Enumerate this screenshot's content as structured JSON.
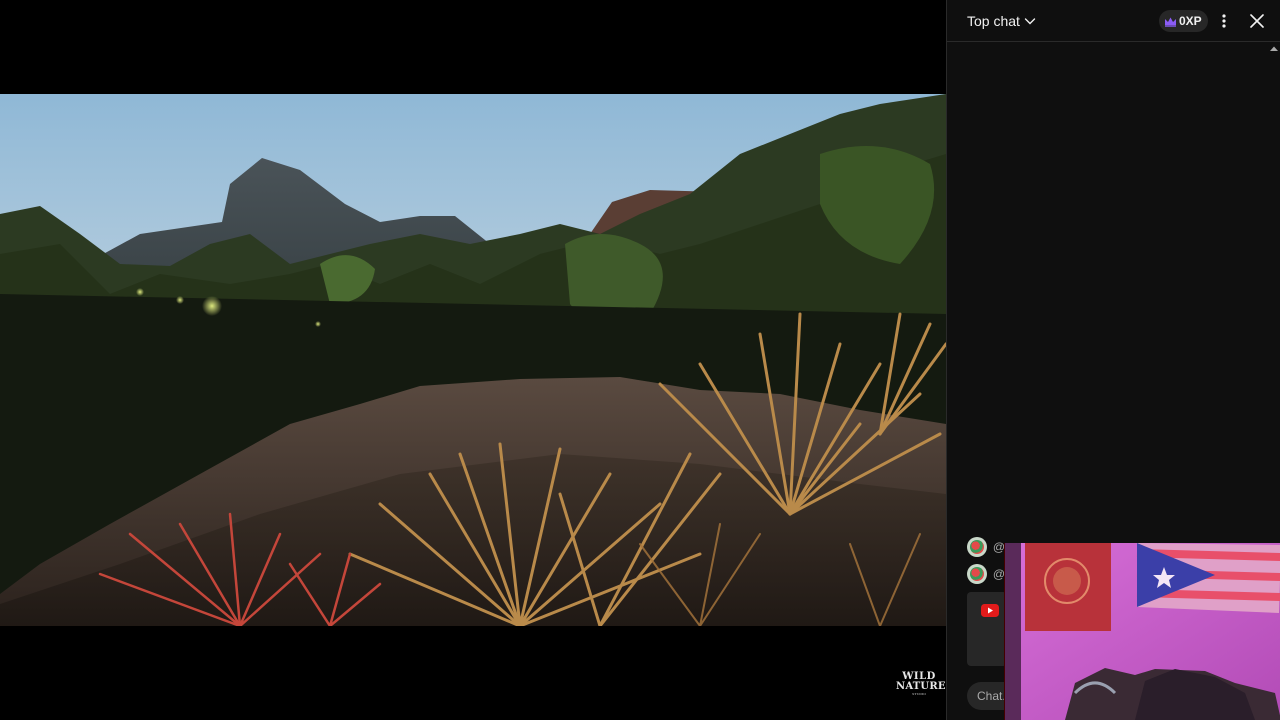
{
  "video": {
    "watermark_line1": "WILD",
    "watermark_line2": "NATURE",
    "watermark_line3": "STUDIO"
  },
  "chat": {
    "mode_label": "Top chat",
    "xp_label": "0XP",
    "messages": [
      {
        "text": "@"
      },
      {
        "text": "@"
      }
    ],
    "input_placeholder": "Chat..."
  },
  "icons": {
    "dropdown": "chevron-down-icon",
    "crown": "crown-icon",
    "more": "more-vert-icon",
    "close": "close-icon",
    "scroll": "scroll-up-icon",
    "promo": "youtube-icon"
  },
  "colors": {
    "panel_bg": "#0f0f0f",
    "badge_bg": "#272727",
    "crown": "#8b5cf6",
    "text": "#f1f1f1",
    "webcam_tint": "#e26ad6"
  }
}
